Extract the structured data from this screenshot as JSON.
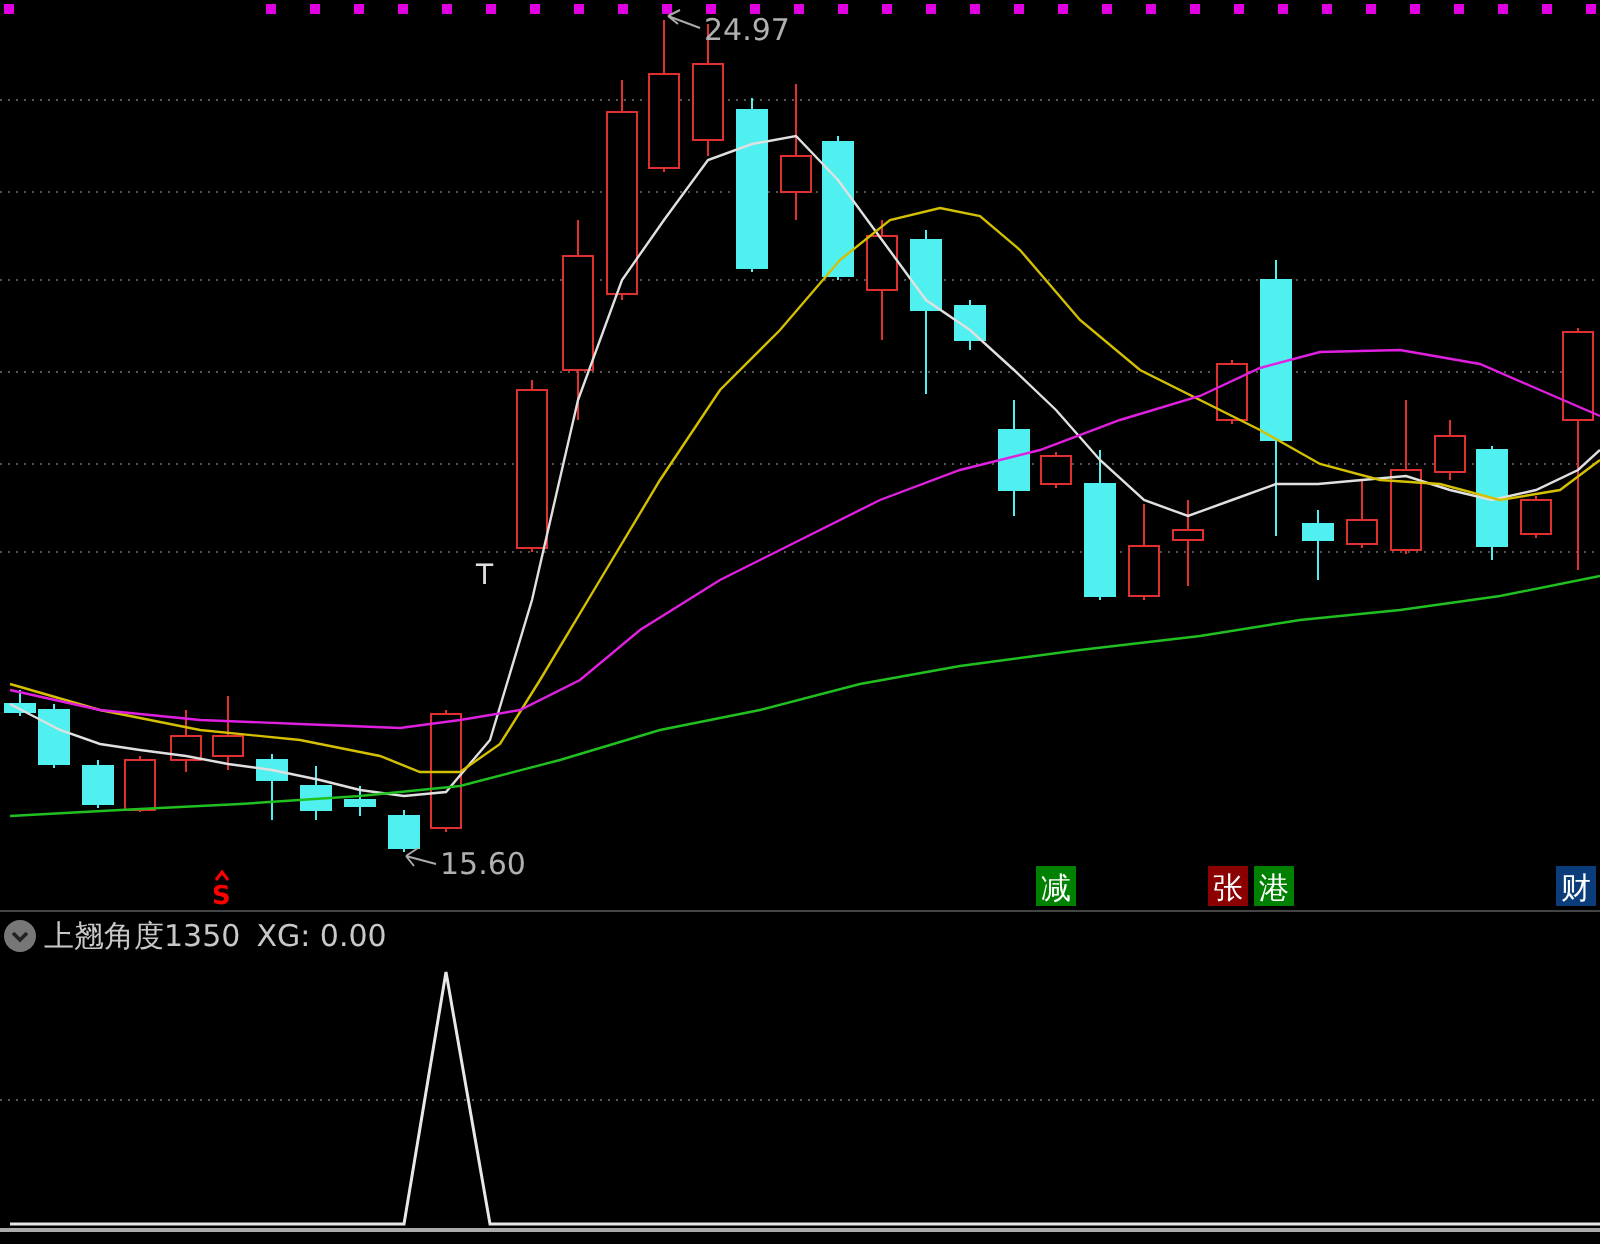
{
  "main_chart": {
    "high_label": "24.97",
    "low_label": "15.60",
    "t_marker": "T",
    "signal_marker": "S",
    "badges": [
      {
        "text": "减",
        "color": "#008000"
      },
      {
        "text": "张",
        "color": "#8b0000"
      },
      {
        "text": "港",
        "color": "#008000"
      },
      {
        "text": "财",
        "color": "#0a3d7a"
      }
    ]
  },
  "indicator": {
    "name": "上翘角度1350",
    "xg_label": "XG: 0.00"
  }
}
